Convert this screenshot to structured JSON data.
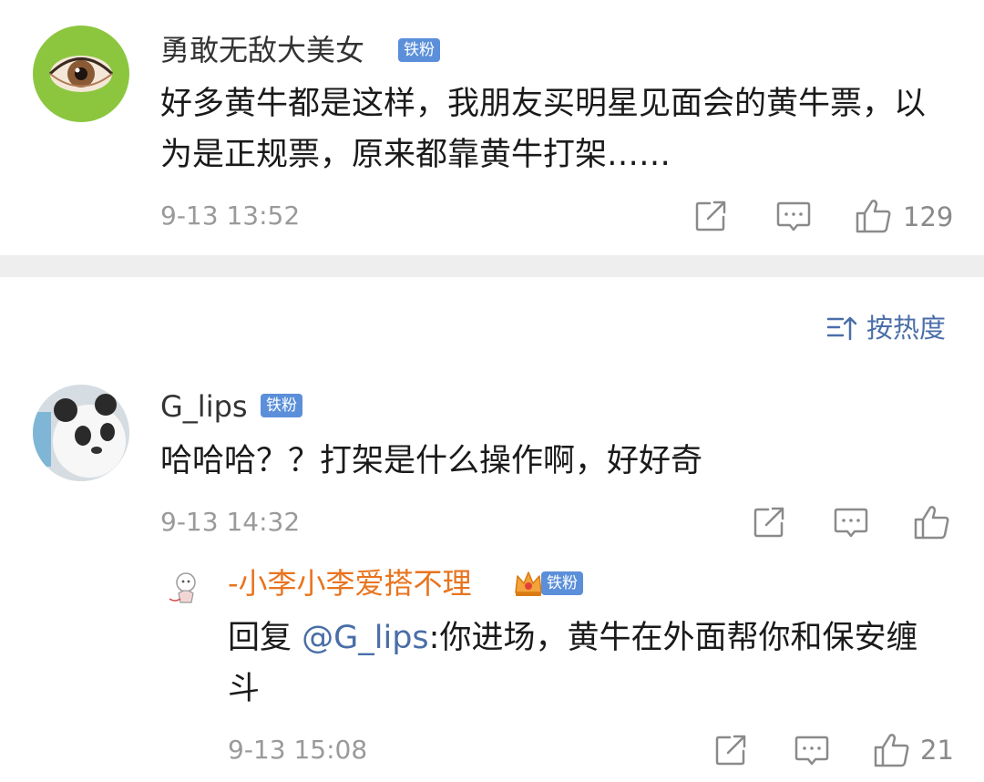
{
  "comments": [
    {
      "username": "勇敢无敌大美女",
      "badge": "铁粉",
      "text": "好多黄牛都是这样，我朋友买明星见面会的黄牛票，以为是正规票，原来都靠黄牛打架……",
      "timestamp": "9-13 13:52",
      "likes": "129"
    },
    {
      "username": "G_lips",
      "badge": "铁粉",
      "text": "哈哈哈？？打架是什么操作啊，好好奇",
      "timestamp": "9-13 14:32",
      "likes": "",
      "reply": {
        "username": "-小李小李爱搭不理",
        "badge": "铁粉",
        "prefix": "回复 ",
        "mention": "@G_lips",
        "text": ":你进场，黄牛在外面帮你和保安缠斗",
        "timestamp": "9-13 15:08",
        "likes": "21"
      }
    }
  ],
  "sort": {
    "label": "按热度"
  },
  "colors": {
    "link": "#4a6ea8",
    "badge": "#5b8fd9",
    "reply_name": "#e8741e"
  }
}
